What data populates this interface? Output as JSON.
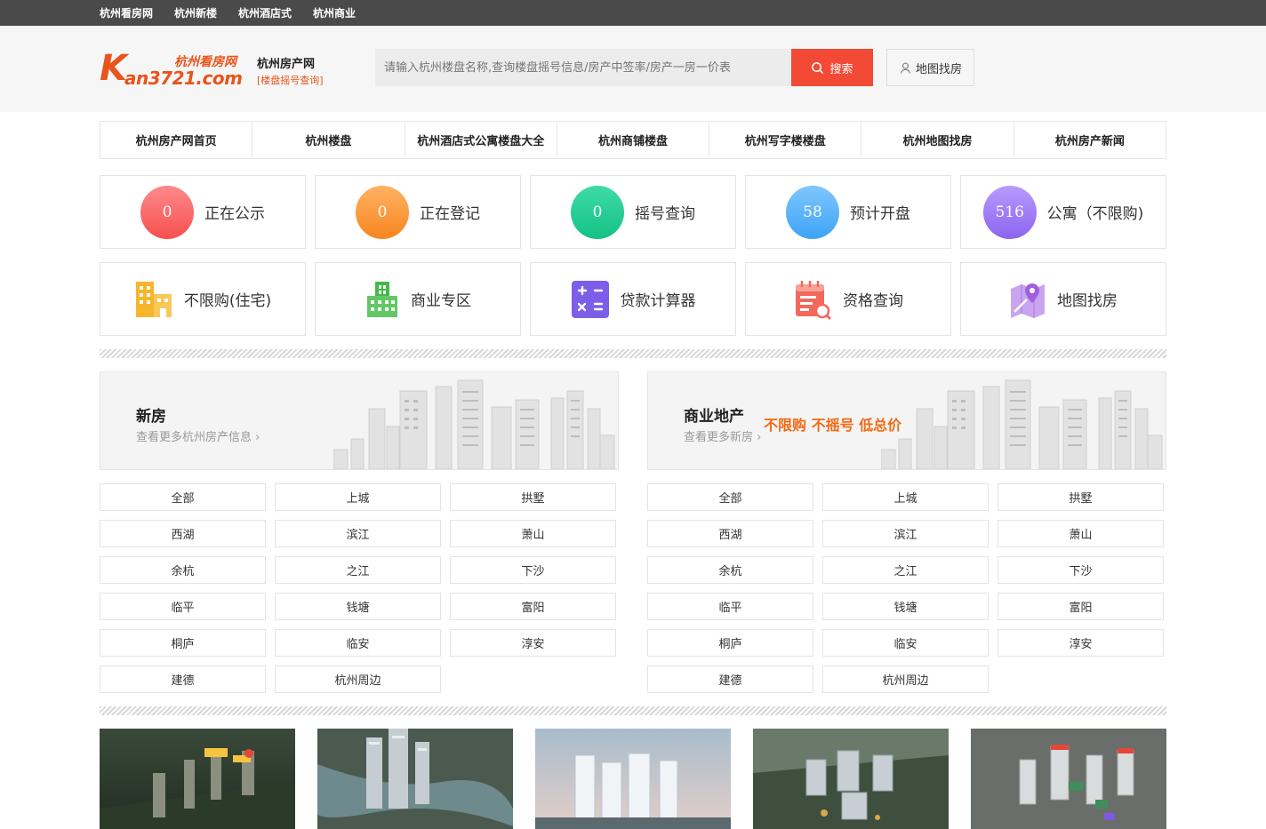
{
  "topbar": {
    "links": [
      "杭州看房网",
      "杭州新楼",
      "杭州酒店式",
      "杭州商业"
    ]
  },
  "header": {
    "logo_main": "Kan3721.com",
    "logo_k": "K",
    "logo_rest": "an3721.com",
    "logo_cn": "杭州看房网",
    "site_name": "杭州房产网",
    "site_sub": "[楼盘摇号查询]",
    "search_placeholder": "请输入杭州楼盘名称,查询楼盘摇号信息/房产中签率/房产一房一价表",
    "search_label": "搜索",
    "map_label": "地图找房"
  },
  "nav": [
    "杭州房产网首页",
    "杭州楼盘",
    "杭州酒店式公寓楼盘大全",
    "杭州商铺楼盘",
    "杭州写字楼楼盘",
    "杭州地图找房",
    "杭州房产新闻"
  ],
  "stats": [
    {
      "count": "0",
      "label": "正在公示",
      "color_a": "#ff8a8a",
      "color_b": "#f5504f"
    },
    {
      "count": "0",
      "label": "正在登记",
      "color_a": "#ffb264",
      "color_b": "#f7861f"
    },
    {
      "count": "0",
      "label": "摇号查询",
      "color_a": "#3fdba7",
      "color_b": "#14c185"
    },
    {
      "count": "58",
      "label": "预计开盘",
      "color_a": "#7fc6ff",
      "color_b": "#3da3f5"
    },
    {
      "count": "516",
      "label": "公寓（不限购)",
      "color_a": "#b79bff",
      "color_b": "#8c64f0"
    }
  ],
  "tools": [
    {
      "icon": "building-icon",
      "label": "不限购(住宅)",
      "color": "#f7b52c"
    },
    {
      "icon": "commercial-building-icon",
      "label": "商业专区",
      "color": "#45b94a"
    },
    {
      "icon": "calculator-icon",
      "label": "贷款计算器",
      "color": "#7c5ee8"
    },
    {
      "icon": "calendar-search-icon",
      "label": "资格查询",
      "color": "#f2685a"
    },
    {
      "icon": "map-pin-icon",
      "label": "地图找房",
      "color": "#b57be8"
    }
  ],
  "new_house": {
    "title": "新房",
    "sub": "查看更多杭州房产信息",
    "areas": [
      "全部",
      "上城",
      "拱墅",
      "西湖",
      "滨江",
      "萧山",
      "余杭",
      "之江",
      "下沙",
      "临平",
      "钱塘",
      "富阳",
      "桐庐",
      "临安",
      "淳安",
      "建德",
      "杭州周边"
    ]
  },
  "commercial": {
    "title": "商业地产",
    "sub": "查看更多新房",
    "promo": "不限购 不摇号 低总价",
    "areas": [
      "全部",
      "上城",
      "拱墅",
      "西湖",
      "滨江",
      "萧山",
      "余杭",
      "之江",
      "下沙",
      "临平",
      "钱塘",
      "富阳",
      "桐庐",
      "临安",
      "淳安",
      "建德",
      "杭州周边"
    ]
  },
  "photos": [
    "aerial-night-photo",
    "aerial-river-photo",
    "towers-dusk-photo",
    "aerial-park-photo",
    "aerial-complex-photo"
  ]
}
